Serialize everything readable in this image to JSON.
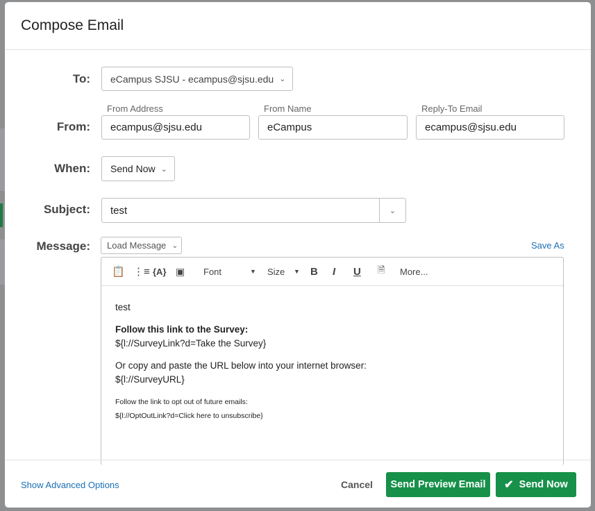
{
  "title": "Compose Email",
  "to": {
    "label": "To:",
    "value": "eCampus SJSU - ecampus@sjsu.edu"
  },
  "from": {
    "label": "From:",
    "address_label": "From Address",
    "address": "ecampus@sjsu.edu",
    "name_label": "From Name",
    "name": "eCampus",
    "reply_label": "Reply-To Email",
    "reply": "ecampus@sjsu.edu"
  },
  "when": {
    "label": "When:",
    "value": "Send Now"
  },
  "subject": {
    "label": "Subject:",
    "value": "test"
  },
  "message": {
    "label": "Message:",
    "load": "Load Message",
    "save_as": "Save As",
    "toolbar": {
      "font": "Font",
      "size": "Size",
      "bold": "B",
      "italic": "I",
      "underline": "U",
      "more": "More..."
    },
    "body": [
      "test",
      "Follow this link to the Survey:",
      "${l://SurveyLink?d=Take the Survey}",
      "Or copy and paste the URL below into your internet browser:",
      "${l://SurveyURL}",
      "Follow the link to opt out of future emails:",
      "${l://OptOutLink?d=Click here to unsubscribe}"
    ]
  },
  "footer": {
    "advanced": "Show Advanced Options",
    "cancel": "Cancel",
    "preview": "Send Preview Email",
    "send": "Send Now"
  },
  "colors": {
    "accent": "#17904a",
    "link": "#1a6fb5"
  }
}
